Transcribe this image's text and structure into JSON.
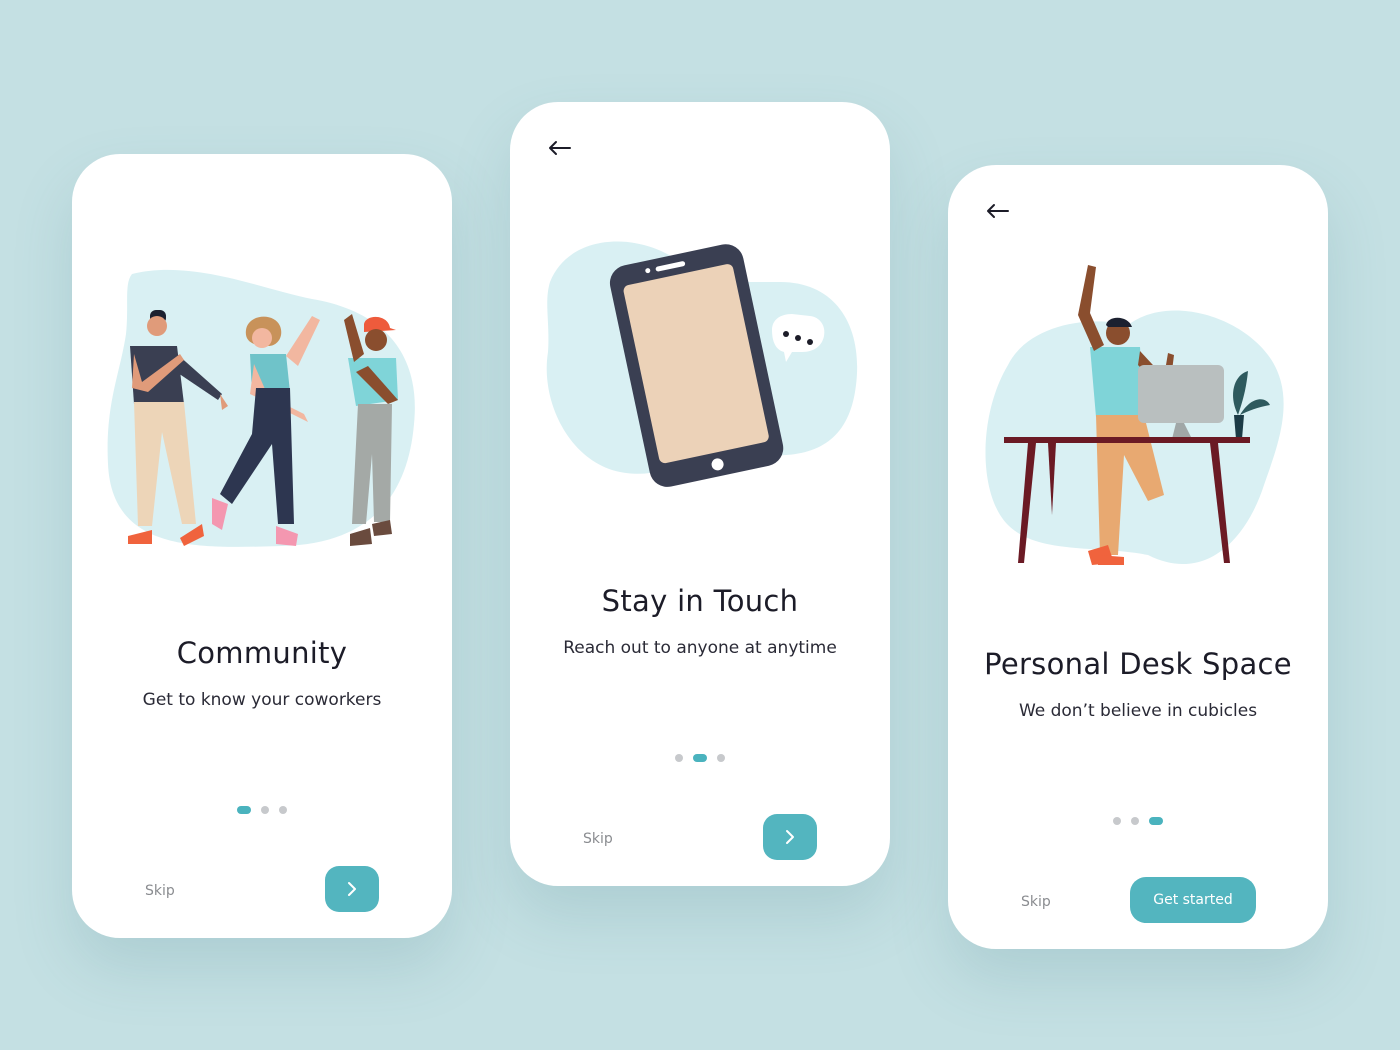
{
  "screens": [
    {
      "title": "Community",
      "subtitle": "Get to know your coworkers",
      "skip_label": "Skip",
      "active_step": 1,
      "total_steps": 3,
      "next_icon": "chevron-right-icon"
    },
    {
      "back_icon": "arrow-left-icon",
      "title": "Stay in Touch",
      "subtitle": "Reach out to anyone at anytime",
      "skip_label": "Skip",
      "active_step": 2,
      "total_steps": 3,
      "next_icon": "chevron-right-icon"
    },
    {
      "back_icon": "arrow-left-icon",
      "title": "Personal Desk Space",
      "subtitle": "We don’t believe in cubicles",
      "skip_label": "Skip",
      "active_step": 3,
      "total_steps": 3,
      "cta_label": "Get started"
    }
  ],
  "colors": {
    "background": "#c4e0e3",
    "accent": "#53b5bf",
    "blob": "#d9f0f3",
    "dot_inactive": "#c7c9cc"
  }
}
